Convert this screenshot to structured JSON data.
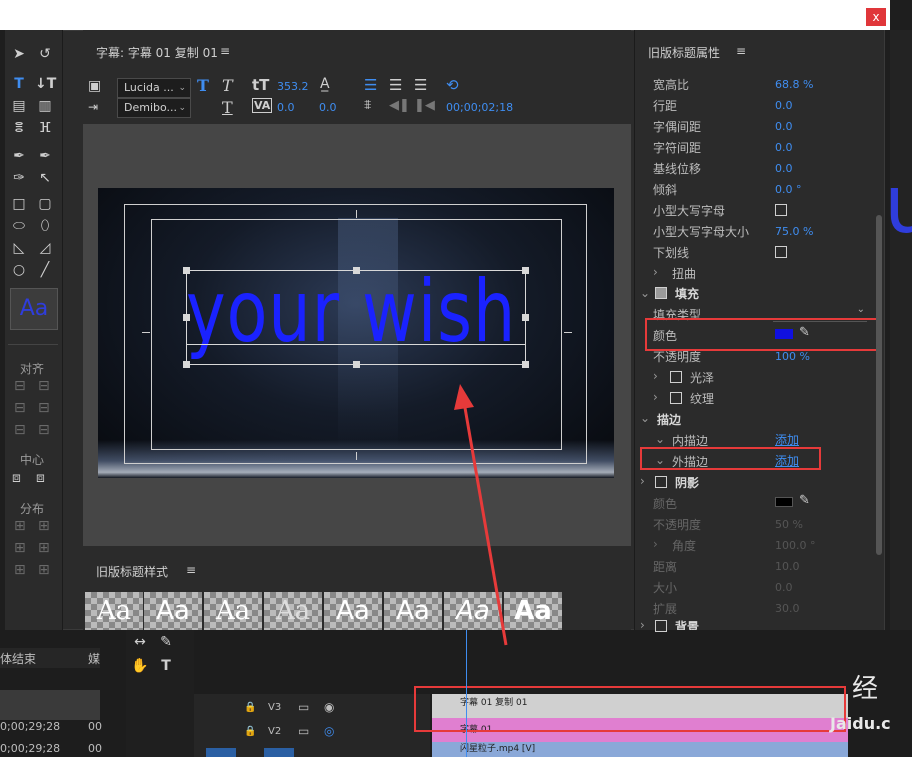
{
  "window": {
    "close_label": "x"
  },
  "title_panel": {
    "title": "字幕: 字幕 01 复制 01",
    "menu_icon": "≡"
  },
  "toolbar": {
    "font_family": "Lucida ...",
    "font_style": "Demibo...",
    "font_size": "353.2",
    "tracking": "0.0",
    "kerning": "0.0",
    "timecode": "00;00;02;18"
  },
  "canvas": {
    "title_text": "your wish",
    "text_color": "#1a22ff"
  },
  "tools_panel": {
    "align_label": "对齐",
    "center_label": "中心",
    "distribute_label": "分布",
    "style_preview": "Aa"
  },
  "styles_panel": {
    "title": "旧版标题样式",
    "swatches": [
      "Aa",
      "Aa",
      "Aa",
      "Aa",
      "Aa",
      "Aa",
      "Aa",
      "Aa"
    ]
  },
  "properties": {
    "title": "旧版标题属性",
    "rows": [
      {
        "label": "宽高比",
        "value": "68.8 %"
      },
      {
        "label": "行距",
        "value": "0.0"
      },
      {
        "label": "字偶间距",
        "value": "0.0"
      },
      {
        "label": "字符间距",
        "value": "0.0"
      },
      {
        "label": "基线位移",
        "value": "0.0"
      },
      {
        "label": "倾斜",
        "value": "0.0 °"
      }
    ],
    "small_caps_label": "小型大写字母",
    "small_caps_size_label": "小型大写字母大小",
    "small_caps_size_value": "75.0 %",
    "underline_label": "下划线",
    "distort_label": "扭曲",
    "fill_label": "填充",
    "fill_type_label": "填充类型",
    "color_label": "颜色",
    "fill_color": "#1010e0",
    "opacity_label": "不透明度",
    "opacity_value": "100 %",
    "sheen_label": "光泽",
    "texture_label": "纹理",
    "stroke_label": "描边",
    "inner_stroke_label": "内描边",
    "inner_stroke_add": "添加",
    "outer_stroke_label": "外描边",
    "outer_stroke_add": "添加",
    "shadow_label": "阴影",
    "shadow_color_label": "颜色",
    "shadow_opacity_label": "不透明度",
    "shadow_opacity_value": "50 %",
    "shadow_angle_label": "角度",
    "shadow_angle_value": "100.0 °",
    "shadow_distance_label": "距离",
    "shadow_distance_value": "10.0",
    "shadow_size_label": "大小",
    "shadow_size_value": "0.0",
    "shadow_spread_label": "扩展",
    "shadow_spread_value": "30.0",
    "background_label": "背景"
  },
  "timeline": {
    "col_end_label": "体结束",
    "col_media_label": "媒",
    "time1": "0;00;29;28",
    "time2": "0;00;29;28",
    "time1b": "00",
    "time2b": "00",
    "track_v3": "V3",
    "track_v2": "V2",
    "clip1": "字幕 01 复制 01",
    "clip2": "字幕 01",
    "clip3": "闪星粒子.mp4 [V]"
  },
  "watermark": {
    "text": "Jaidu.c",
    "logo": "经"
  }
}
